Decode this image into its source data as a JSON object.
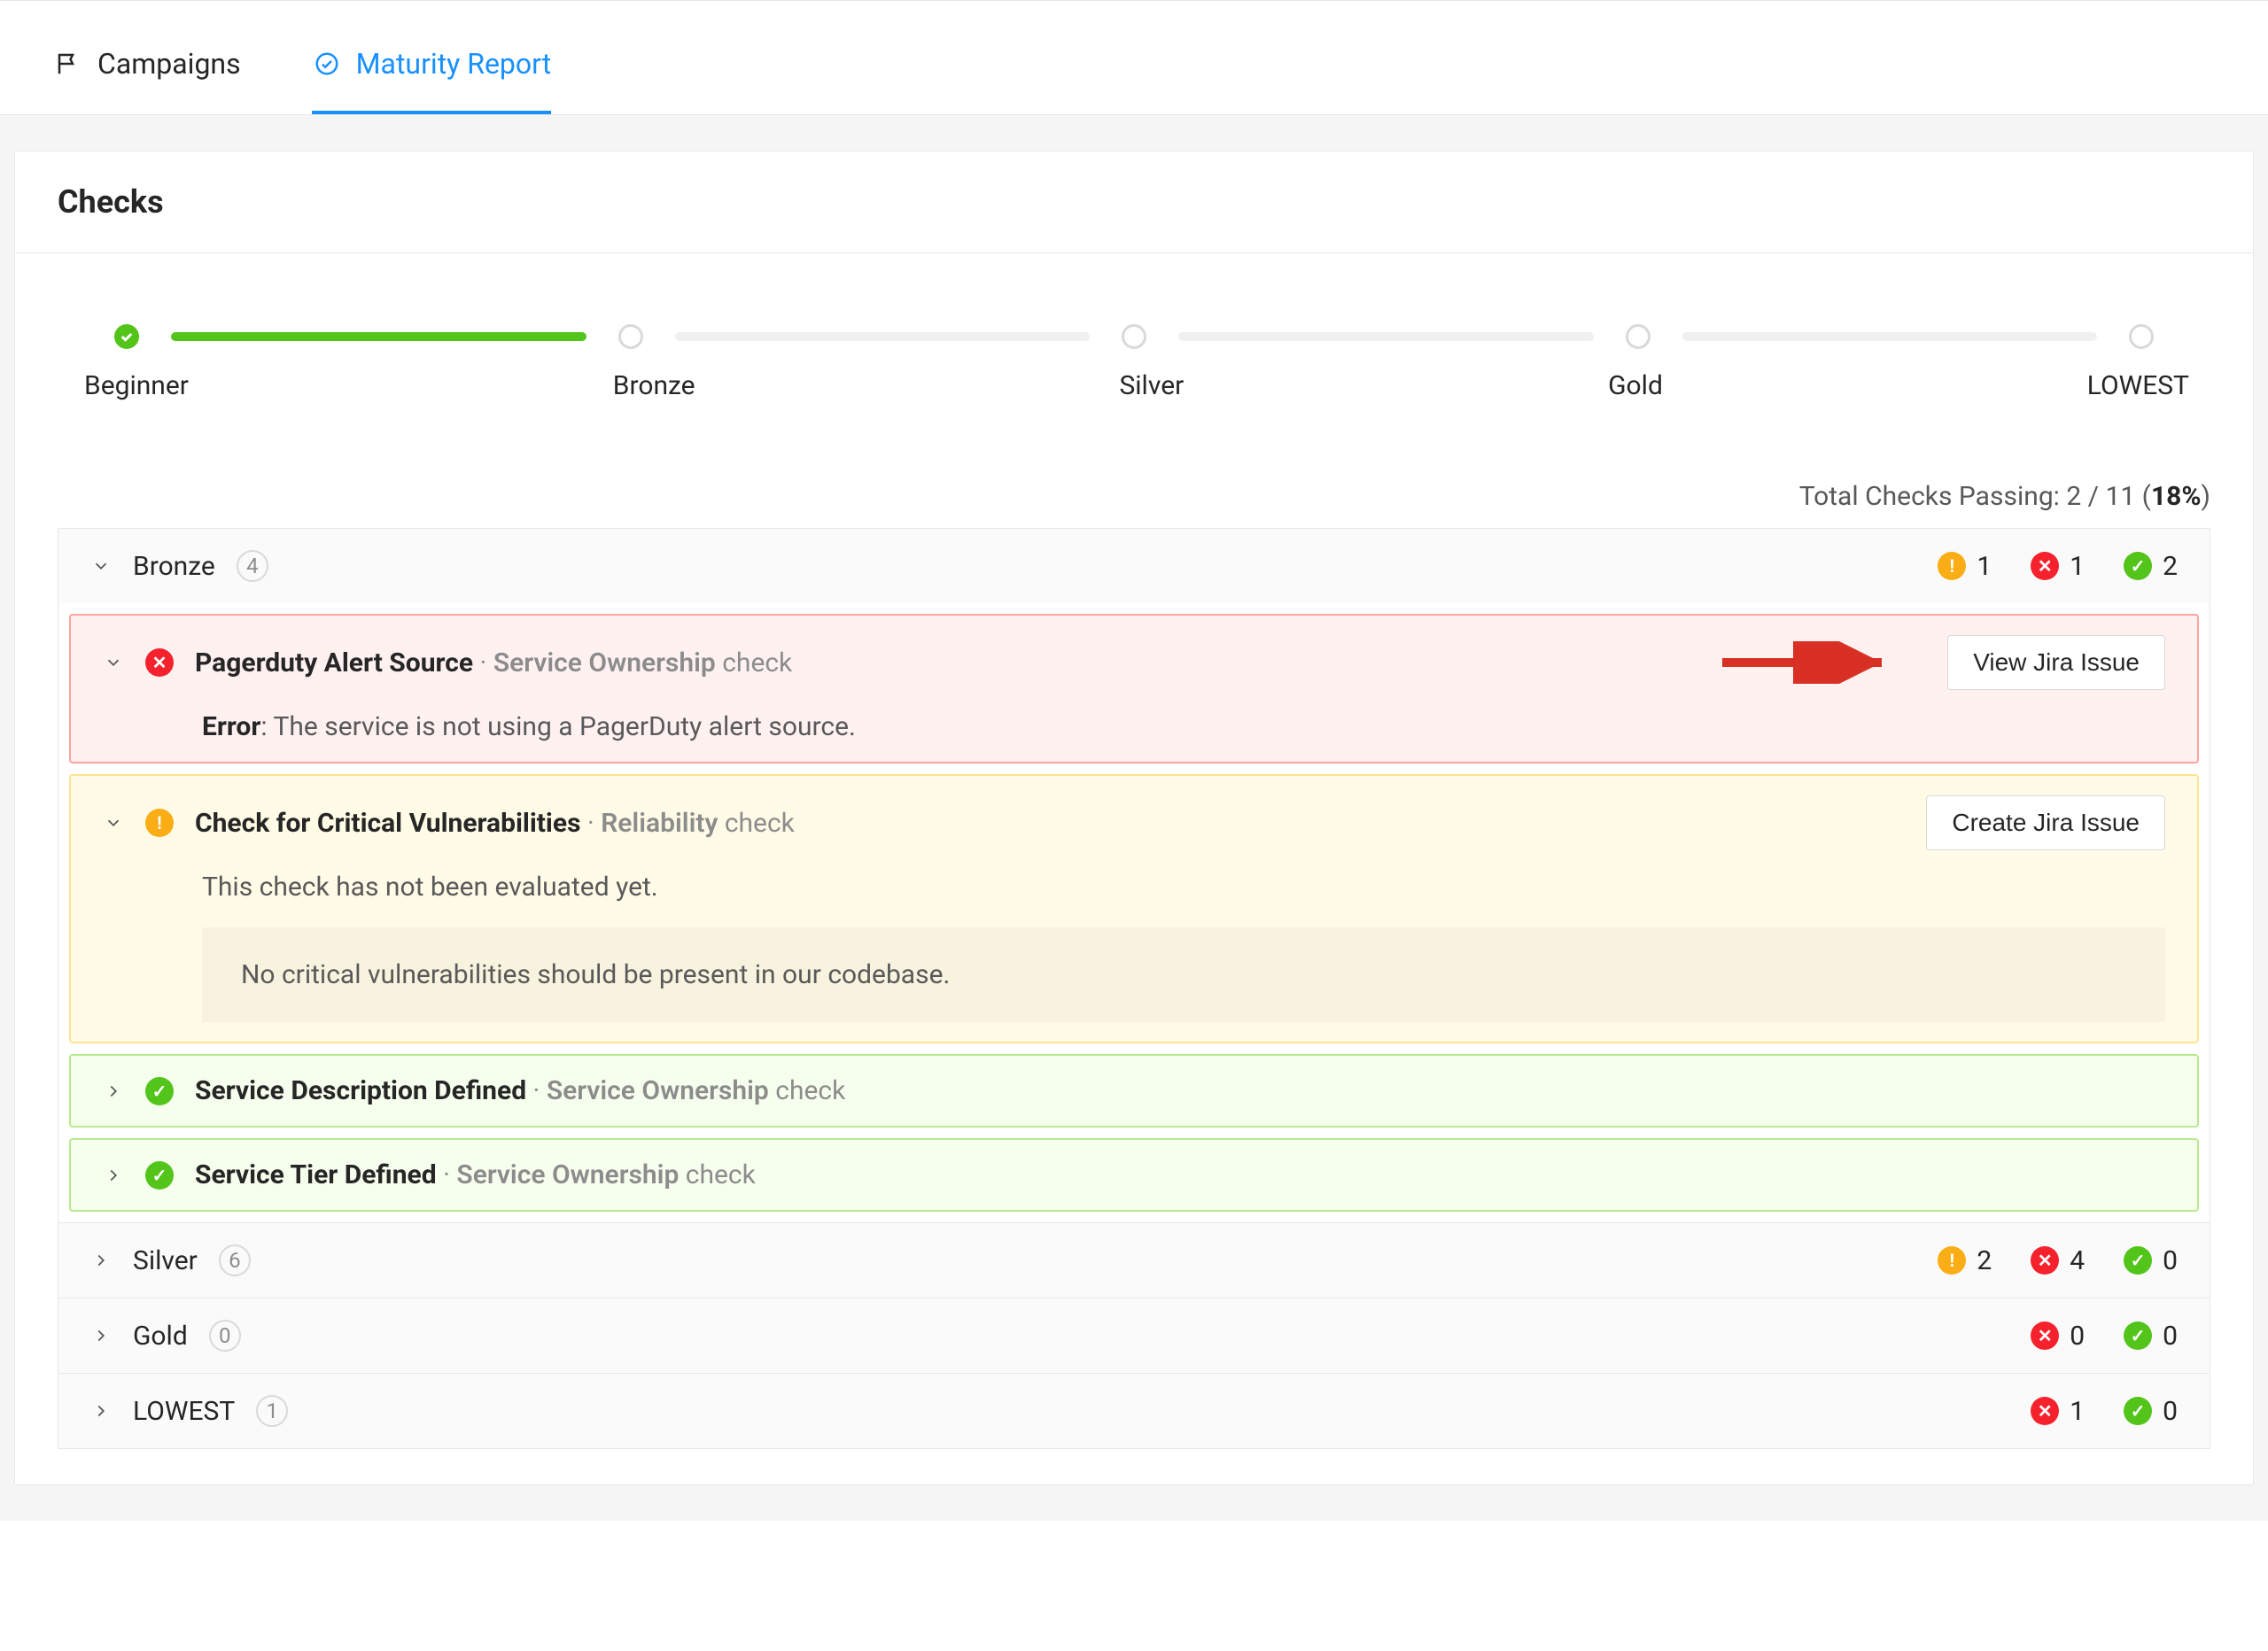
{
  "tabs": {
    "campaigns": "Campaigns",
    "maturity": "Maturity Report"
  },
  "card": {
    "title": "Checks"
  },
  "steps": [
    "Beginner",
    "Bronze",
    "Silver",
    "Gold",
    "LOWEST"
  ],
  "total": {
    "prefix": "Total Checks Passing: ",
    "value": "2 / 11",
    "pct": "18%"
  },
  "words": {
    "check": "check",
    "dot": "·",
    "error": "Error",
    "paren_open": " (",
    "paren_close": ")"
  },
  "levels": {
    "bronze": {
      "name": "Bronze",
      "count": "4",
      "warn": "1",
      "fail": "1",
      "pass": "2",
      "expanded": true
    },
    "silver": {
      "name": "Silver",
      "count": "6",
      "warn": "2",
      "fail": "4",
      "pass": "0",
      "expanded": false
    },
    "gold": {
      "name": "Gold",
      "count": "0",
      "fail": "0",
      "pass": "0",
      "expanded": false
    },
    "lowest": {
      "name": "LOWEST",
      "count": "1",
      "fail": "1",
      "pass": "0",
      "expanded": false
    }
  },
  "checks": {
    "pagerduty": {
      "title": "Pagerduty Alert Source",
      "category": "Service Ownership",
      "button": "View Jira Issue",
      "error": ": The service is not using a PagerDuty alert source."
    },
    "vuln": {
      "title": "Check for Critical Vulnerabilities",
      "category": "Reliability",
      "button": "Create Jira Issue",
      "msg": "This check has not been evaluated yet.",
      "note": "No critical vulnerabilities should be present in our codebase."
    },
    "desc": {
      "title": "Service Description Defined",
      "category": "Service Ownership"
    },
    "tier": {
      "title": "Service Tier Defined",
      "category": "Service Ownership"
    }
  }
}
